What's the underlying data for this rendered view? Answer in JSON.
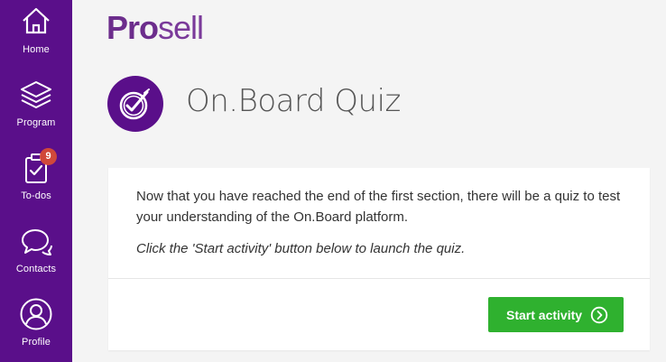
{
  "sidebar": {
    "items": [
      {
        "label": "Home",
        "icon": "home-icon"
      },
      {
        "label": "Program",
        "icon": "layers-icon"
      },
      {
        "label": "To-dos",
        "icon": "clipboard-check-icon",
        "badge": "9"
      },
      {
        "label": "Contacts",
        "icon": "chat-bubbles-icon"
      },
      {
        "label": "Profile",
        "icon": "user-icon"
      }
    ],
    "color": "#5a0f8a"
  },
  "brand": {
    "bold": "Pro",
    "rest": "sell",
    "color": "#6c2d8c"
  },
  "page": {
    "title": "On.Board Quiz",
    "icon": "quiz-check-icon"
  },
  "card": {
    "description": "Now that you have reached the end of the first section, there will be a quiz to test your understanding of the On.Board platform.",
    "hint": "Click the 'Start activity' button below to launch the quiz.",
    "button_label": "Start activity",
    "button_color": "#2fb12f"
  }
}
